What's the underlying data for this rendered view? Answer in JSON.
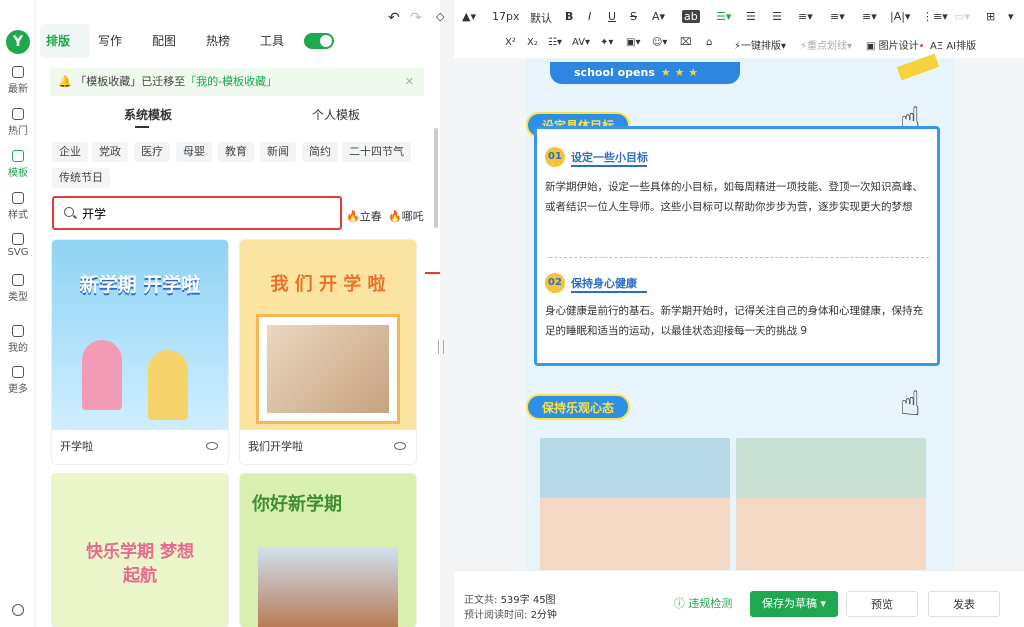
{
  "brand": {
    "logo": "Y",
    "accent": "#1fa84f",
    "highlight": "#e23b3b"
  },
  "rail": [
    {
      "label": "最新",
      "icon": "chat-icon"
    },
    {
      "label": "热门",
      "icon": "fire-icon"
    },
    {
      "label": "模板",
      "icon": "template-icon"
    },
    {
      "label": "样式",
      "icon": "style-icon"
    },
    {
      "label": "SVG",
      "icon": "svg-icon"
    },
    {
      "label": "类型",
      "icon": "type-icon"
    },
    {
      "label": "我的",
      "icon": "user-icon"
    },
    {
      "label": "更多",
      "icon": "grid-icon"
    }
  ],
  "tabs": [
    "排版",
    "写作",
    "配图",
    "热榜",
    "工具"
  ],
  "notice": {
    "text1": "「模板收藏」已迁移至",
    "text2": "「我的-模板收藏」"
  },
  "subtabs": [
    "系统模板",
    "个人模板"
  ],
  "categories": [
    "企业",
    "党政",
    "医疗",
    "母婴",
    "教育",
    "新闻",
    "简约",
    "二十四节气",
    "传统节日"
  ],
  "search": {
    "value": "开学"
  },
  "hot": [
    "立春",
    "哪吒"
  ],
  "templates": [
    {
      "name": "开学啦",
      "headline": "新学期 开学啦"
    },
    {
      "name": "我们开学啦",
      "headline": "我 们 开 学 啦"
    },
    {
      "name": "",
      "headline": "快乐学期 梦想起航"
    },
    {
      "name": "",
      "headline": "你好新学期"
    }
  ],
  "toolbar": {
    "font_size": "17px",
    "font": "默认",
    "row2": [
      "一键排版",
      "重点划线",
      "图片设计",
      "AI排版"
    ]
  },
  "doc": {
    "banner": "school opens",
    "section1": "设定具体目标",
    "item1_num": "01",
    "item1_title": "设定一些小目标",
    "item1_body": "新学期伊始，设定一些具体的小目标，如每周精进一项技能、登顶一次知识高峰、或者结识一位人生导师。这些小目标可以帮助你步步为营，逐步实现更大的梦想",
    "item2_num": "02",
    "item2_title": "保持身心健康",
    "item2_body": "身心健康是前行的基石。新学期开始时，记得关注自己的身体和心理健康，保持充足的睡眠和适当的运动，以最佳状态迎接每一天的挑战 9",
    "section2": "保持乐观心态"
  },
  "footer": {
    "words_label": "正文共:",
    "words": "539字 45图",
    "read_label": "预计阅读时间:",
    "read": "2分钟",
    "check": "违规检测",
    "save": "保存为草稿",
    "preview": "预览",
    "publish": "发表"
  }
}
